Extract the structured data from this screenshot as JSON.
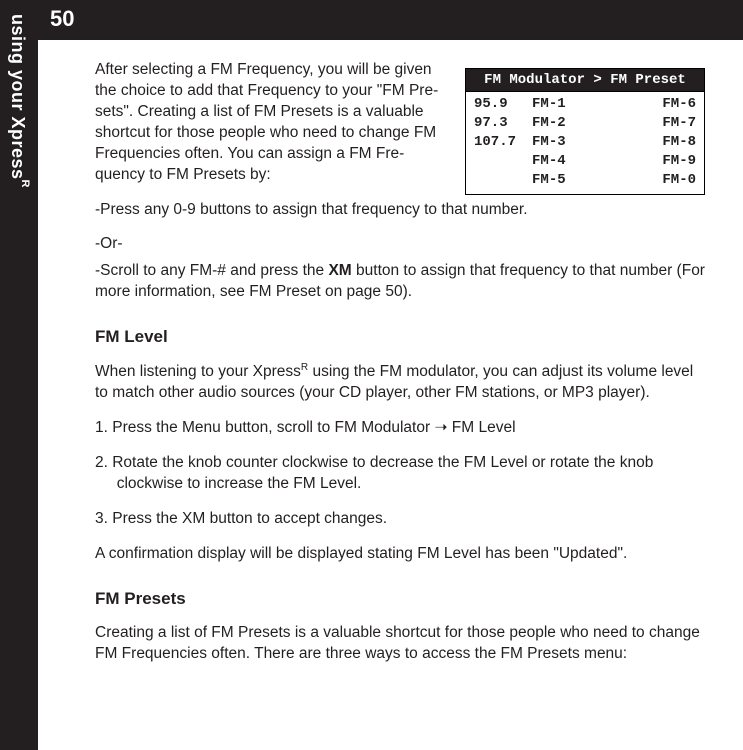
{
  "sidebar": {
    "label_pre": "using your Xpress",
    "label_sup": "R"
  },
  "pagebar": {
    "num": "50"
  },
  "fm_table": {
    "title": "FM Modulator > FM Preset",
    "freqs": [
      "95.9",
      "97.3",
      "107.7",
      "",
      ""
    ],
    "col2": [
      "FM-1",
      "FM-2",
      "FM-3",
      "FM-4",
      "FM-5"
    ],
    "col3": [
      "FM-6",
      "FM-7",
      "FM-8",
      "FM-9",
      "FM-0"
    ]
  },
  "intro": {
    "p1": "After selecting a FM Frequency, you will be given the choice to add that Frequency to your \"FM Pre-sets\".  Creating a list of FM Presets is a valuable shortcut for those people who need to change FM Frequencies often. You can assign a FM Fre-quency to FM Presets by:",
    "p2": "-Press any 0-9 buttons to assign that frequency to that number.",
    "p3": "-Or-",
    "p4_pre": "-Scroll to any FM-# and press the ",
    "p4_b": "XM",
    "p4_post": " button to assign that frequency to that number (For more information, see FM Preset on page 50)."
  },
  "fmlevel": {
    "heading": "FM Level",
    "intro_pre": "When listening to your Xpress",
    "intro_sup": "R",
    "intro_post": " using the FM modulator, you can adjust its volume level to match other audio sources (your CD player, other FM stations, or MP3 player).",
    "s1_pre": "1. Press the ",
    "s1_b1": "Menu",
    "s1_mid": " button, scroll to ",
    "s1_b2": "FM Modulator",
    "s1_arrow": " ➝ ",
    "s1_b3": "FM Level",
    "s2": "2. Rotate the knob counter clockwise to decrease the FM Level or rotate the knob clockwise to increase the FM Level.",
    "s3_pre": "3. Press the ",
    "s3_b": "XM",
    "s3_post": " button to accept changes.",
    "confirm": "A confirmation display will be displayed stating FM Level has been \"Updated\"."
  },
  "fmpresets": {
    "heading": "FM Presets",
    "p": "Creating a list of FM Presets is a valuable shortcut for those people who need to change FM Frequencies often. There are three ways to access the FM Presets menu:"
  }
}
